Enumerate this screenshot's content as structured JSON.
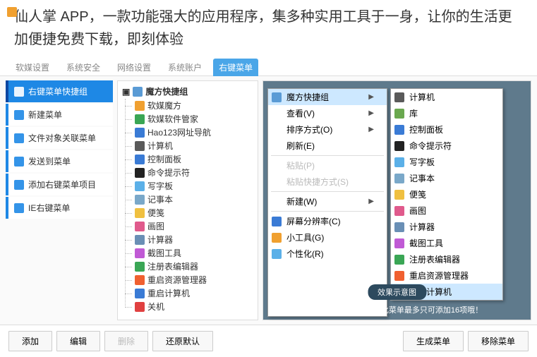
{
  "header_text": "仙人掌 APP，一款功能强大的应用程序，集多种实用工具于一身，让你的生活更加便捷免费下载，即刻体验",
  "tabs": [
    {
      "label": "软媒设置",
      "active": false
    },
    {
      "label": "系统安全",
      "active": false
    },
    {
      "label": "网络设置",
      "active": false
    },
    {
      "label": "系统账户",
      "active": false
    },
    {
      "label": "右键菜单",
      "active": true
    }
  ],
  "sidebar": [
    {
      "key": "shortcut-group",
      "label": "右键菜单快捷组",
      "icon": "grid-icon",
      "active": true
    },
    {
      "key": "new-menu",
      "label": "新建菜单",
      "icon": "plus-icon",
      "active": false
    },
    {
      "key": "file-assoc",
      "label": "文件对象关联菜单",
      "icon": "file-icon",
      "active": false
    },
    {
      "key": "send-to",
      "label": "发送到菜单",
      "icon": "send-icon",
      "active": false
    },
    {
      "key": "add-context",
      "label": "添加右键菜单项目",
      "icon": "add-icon",
      "active": false
    },
    {
      "key": "ie-context",
      "label": "IE右键菜单",
      "icon": "ie-icon",
      "active": false
    }
  ],
  "tree": {
    "root": "魔方快捷组",
    "items": [
      {
        "label": "软媒魔方",
        "color": "#f0a030"
      },
      {
        "label": "软媒软件管家",
        "color": "#3aa655"
      },
      {
        "label": "Hao123网址导航",
        "color": "#3a7bd5"
      },
      {
        "label": "计算机",
        "color": "#5a5a5a"
      },
      {
        "label": "控制面板",
        "color": "#3a7bd5"
      },
      {
        "label": "命令提示符",
        "color": "#222"
      },
      {
        "label": "写字板",
        "color": "#5bb0e8"
      },
      {
        "label": "记事本",
        "color": "#7aa8c9"
      },
      {
        "label": "便笺",
        "color": "#f0c040"
      },
      {
        "label": "画图",
        "color": "#e05a8c"
      },
      {
        "label": "计算器",
        "color": "#6a8fb5"
      },
      {
        "label": "截图工具",
        "color": "#c05ad5"
      },
      {
        "label": "注册表编辑器",
        "color": "#3aa655"
      },
      {
        "label": "重启资源管理器",
        "color": "#f06030"
      },
      {
        "label": "重启计算机",
        "color": "#3a7bd5"
      },
      {
        "label": "关机",
        "color": "#e04040"
      }
    ]
  },
  "context_left": [
    {
      "label": "魔方快捷组",
      "icon": "#5a9bd5",
      "arrow": true,
      "hl": true
    },
    {
      "label": "查看(V)",
      "arrow": true
    },
    {
      "label": "排序方式(O)",
      "arrow": true
    },
    {
      "label": "刷新(E)"
    },
    {
      "sep": true
    },
    {
      "label": "粘贴(P)",
      "disabled": true
    },
    {
      "label": "粘贴快捷方式(S)",
      "disabled": true
    },
    {
      "sep": true
    },
    {
      "label": "新建(W)",
      "arrow": true
    },
    {
      "sep": true
    },
    {
      "label": "屏幕分辨率(C)",
      "icon": "#3a7bd5"
    },
    {
      "label": "小工具(G)",
      "icon": "#f0a030"
    },
    {
      "label": "个性化(R)",
      "icon": "#5bb0e8"
    }
  ],
  "context_right": [
    {
      "label": "计算机",
      "icon": "#5a5a5a"
    },
    {
      "label": "库",
      "icon": "#6aa84f"
    },
    {
      "label": "控制面板",
      "icon": "#3a7bd5"
    },
    {
      "label": "命令提示符",
      "icon": "#222"
    },
    {
      "label": "写字板",
      "icon": "#5bb0e8"
    },
    {
      "label": "记事本",
      "icon": "#7aa8c9"
    },
    {
      "label": "便笺",
      "icon": "#f0c040"
    },
    {
      "label": "画图",
      "icon": "#e05a8c"
    },
    {
      "label": "计算器",
      "icon": "#6a8fb5"
    },
    {
      "label": "截图工具",
      "icon": "#c05ad5"
    },
    {
      "label": "注册表编辑器",
      "icon": "#3aa655"
    },
    {
      "label": "重启资源管理器",
      "icon": "#f06030"
    },
    {
      "label": "重启计算机",
      "icon": "#3a7bd5",
      "hl": true
    }
  ],
  "effect_badge": "效果示意图",
  "hint": "小提示：微软限制，此菜单最多只可添加16项哦！",
  "buttons": {
    "add": "添加",
    "edit": "编辑",
    "delete": "删除",
    "restore": "还原默认",
    "generate": "生成菜单",
    "remove": "移除菜单"
  }
}
